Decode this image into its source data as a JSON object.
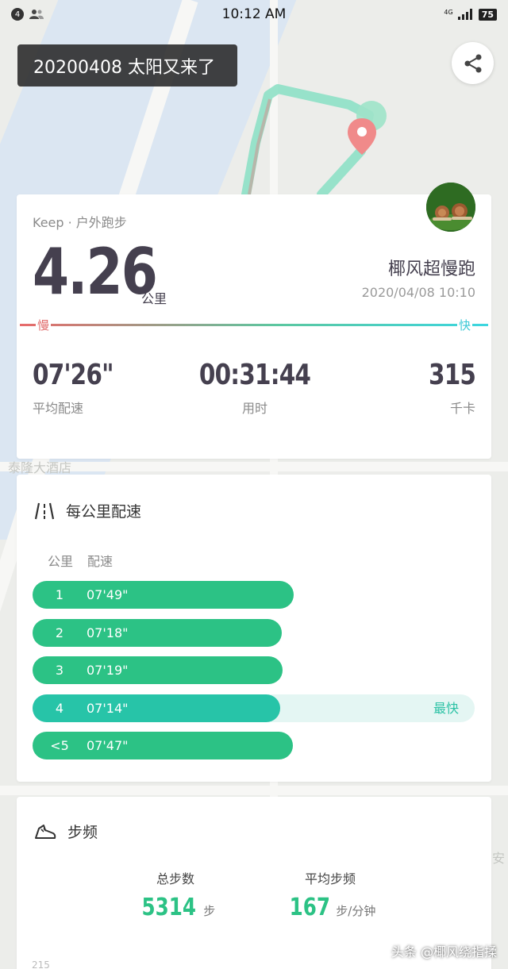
{
  "status_bar": {
    "notification_count": "4",
    "time": "10:12 AM",
    "network": "4G",
    "battery": "75"
  },
  "header": {
    "title": "20200408 太阳又来了",
    "share_icon": "share-icon"
  },
  "map": {
    "labels": [
      "泰隆大酒店",
      "安"
    ]
  },
  "summary": {
    "source": "Keep · 户外跑步",
    "distance": "4.26",
    "distance_unit": "公里",
    "user_name": "椰风超慢跑",
    "datetime": "2020/04/08 10:10",
    "slow_label": "慢",
    "fast_label": "快",
    "stats": [
      {
        "value": "07'26\"",
        "label": "平均配速"
      },
      {
        "value": "00:31:44",
        "label": "用时"
      },
      {
        "value": "315",
        "label": "千卡"
      }
    ]
  },
  "splits": {
    "title": "每公里配速",
    "col_km": "公里",
    "col_pace": "配速",
    "fastest_label": "最快",
    "rows": [
      {
        "km": "1",
        "pace": "07'49\"",
        "fill": 0.59,
        "fastest": false
      },
      {
        "km": "2",
        "pace": "07'18\"",
        "fill": 0.564,
        "fastest": false
      },
      {
        "km": "3",
        "pace": "07'19\"",
        "fill": 0.565,
        "fastest": false
      },
      {
        "km": "4",
        "pace": "07'14\"",
        "fill": 0.56,
        "fastest": true
      },
      {
        "km": "<5",
        "pace": "07'47\"",
        "fill": 0.588,
        "fastest": false
      }
    ]
  },
  "cadence": {
    "title": "步频",
    "total_steps_label": "总步数",
    "total_steps": "5314",
    "total_steps_unit": "步",
    "avg_cadence_label": "平均步频",
    "avg_cadence": "167",
    "avg_cadence_unit": "步/分钟",
    "axis_tick": "215"
  },
  "watermark": "头条 @椰风绕指揉",
  "colors": {
    "accent_green": "#2cc285",
    "fastest_teal": "#27c4a8",
    "text_dark": "#45404f",
    "slow_red": "#e06a6a",
    "fast_cyan": "#3cc9d6"
  }
}
